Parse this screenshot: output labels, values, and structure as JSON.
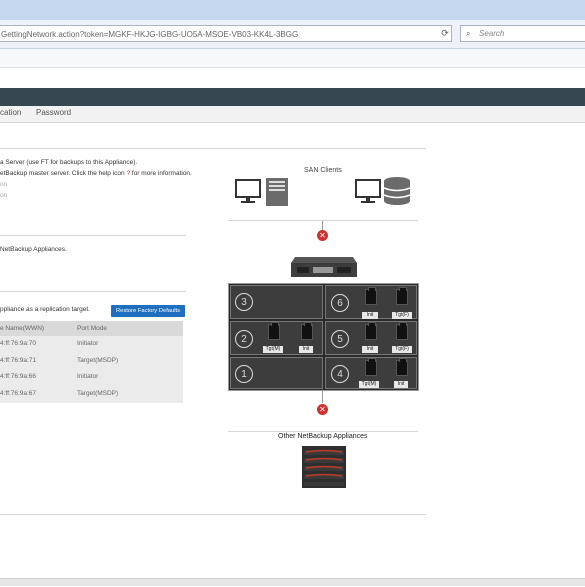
{
  "browser": {
    "url": "GettingNetwork.action?token=MGKF-HKJG-IGBG-UO5A-MSOE-VB03-KK4L-3BGG",
    "refresh_icon": "refresh-icon",
    "search_placeholder": "Search"
  },
  "tabs": [
    "cation",
    "Password"
  ],
  "left_panel": {
    "lines": [
      "a Server (use FT for backups to this Appliance).",
      "etBackup master server. Click the help icon ",
      " for more information.",
      "on",
      "on"
    ],
    "help_glyph": "?",
    "section2": "NetBackup Appliances.",
    "section3": "ppliance as a replication target.",
    "restore_button": "Restore Factory Defaults",
    "table": {
      "headers": [
        "e Name(WWN)",
        "Port Mode"
      ],
      "rows": [
        [
          "4:ff:76:9a:70",
          "Initiator"
        ],
        [
          "4:ff:76:9a:71",
          "Target(MSDP)"
        ],
        [
          "4:ff:76:9a:66",
          "Initiator"
        ],
        [
          "4:ff:76:9a:67",
          "Target(MSDP)"
        ]
      ]
    }
  },
  "diagram": {
    "san_clients_label": "SAN Clients",
    "other_appliances_label": "Other NetBackup Appliances",
    "slots": {
      "s1": "1",
      "s2": "2",
      "s3": "3",
      "s4": "4",
      "s5": "5",
      "s6": "6"
    },
    "port_labels": {
      "s2a": "Tgt(M)",
      "s2b": "Init",
      "s4a": "Tgt(M)",
      "s4b": "Init",
      "s5a": "Init",
      "s5b": "Tgt(F)",
      "s6a": "Init",
      "s6b": "Tgt(F)"
    },
    "x_glyph": "✕",
    "colors": {
      "error_red": "#d0302e",
      "button_blue": "#1f6fc1",
      "appbar": "#37474f"
    }
  }
}
